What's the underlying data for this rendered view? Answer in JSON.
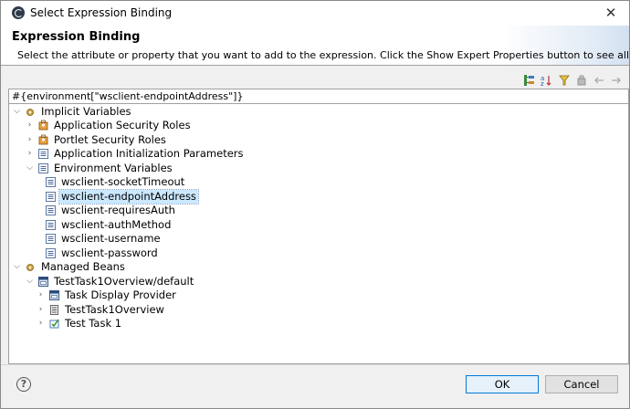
{
  "window": {
    "title": "Select Expression Binding"
  },
  "banner": {
    "heading": "Expression Binding",
    "description": "Select the attribute or property that you want to add to the expression. Click the Show Expert Properties button to see all available choices."
  },
  "toolbar": {
    "icons": [
      "show-expert-properties-icon",
      "sort-icon",
      "filter-icon",
      "bean-icon",
      "back-arrow-icon",
      "forward-arrow-icon"
    ]
  },
  "expression": {
    "value": "#{environment[\"wsclient-endpointAddress\"]}"
  },
  "tree": {
    "implicit_variables": {
      "label": "Implicit Variables",
      "children": [
        {
          "label": "Application Security Roles"
        },
        {
          "label": "Portlet Security Roles"
        },
        {
          "label": "Application Initialization Parameters"
        },
        {
          "label": "Environment Variables",
          "children": [
            {
              "label": "wsclient-socketTimeout"
            },
            {
              "label": "wsclient-endpointAddress"
            },
            {
              "label": "wsclient-requiresAuth"
            },
            {
              "label": "wsclient-authMethod"
            },
            {
              "label": "wsclient-username"
            },
            {
              "label": "wsclient-password"
            }
          ]
        }
      ]
    },
    "managed_beans": {
      "label": "Managed Beans",
      "children": [
        {
          "label": "TestTask1Overview/default",
          "children": [
            {
              "label": "Task Display Provider"
            },
            {
              "label": "TestTask1Overview"
            },
            {
              "label": "Test Task 1"
            }
          ]
        }
      ]
    }
  },
  "footer": {
    "help": "?",
    "ok": "OK",
    "cancel": "Cancel"
  }
}
